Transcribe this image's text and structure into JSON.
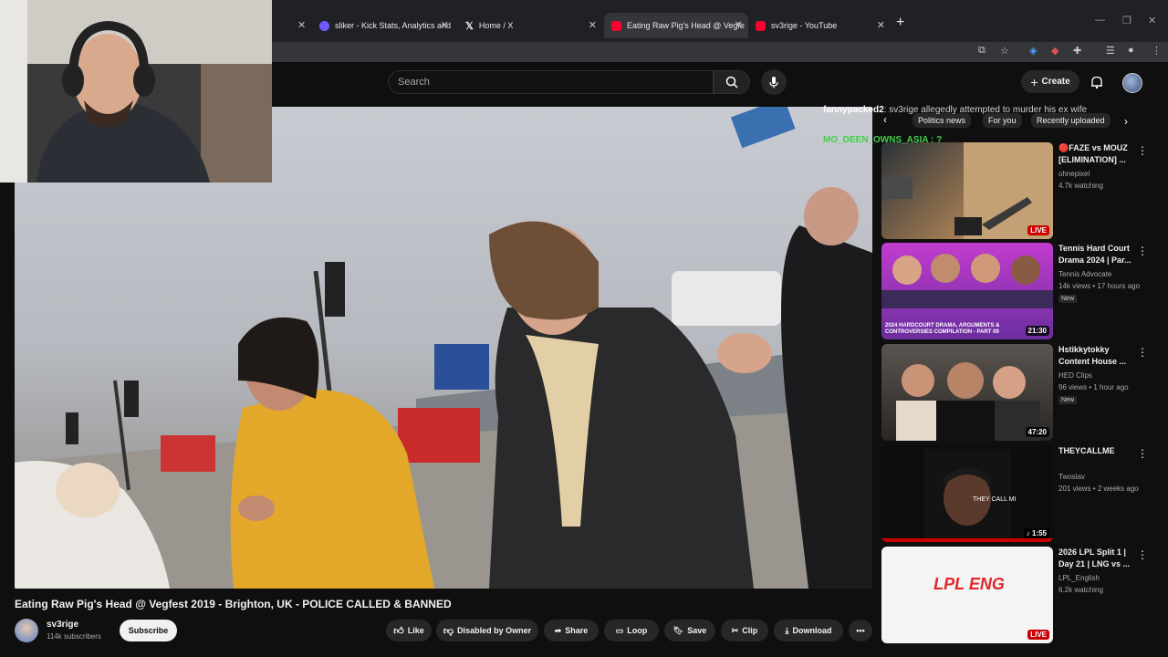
{
  "browser": {
    "tabs": [
      {
        "label": "sliker - Kick Stats, Analytics and",
        "color": "#6e5bff"
      },
      {
        "label": "Home / X",
        "color": "#ffffff"
      },
      {
        "label": "Eating Raw Pig's Head @ Vegfe",
        "color": "#ff0033"
      },
      {
        "label": "sv3rige - YouTube",
        "color": "#ff0033"
      }
    ]
  },
  "header": {
    "search_placeholder": "Search",
    "create_label": "Create"
  },
  "chat": {
    "line1_user": "fannypacked2",
    "line1_text": ": sv3rige allegedly attempted to murder his ex wife",
    "line2_user": "MO_DEEN_OWNS_ASIA",
    "line2_text": ": ?"
  },
  "chips": [
    "Politics news",
    "For you",
    "Recently uploaded"
  ],
  "video": {
    "title": "Eating Raw Pig's Head @ Vegfest 2019 - Brighton, UK - POLICE CALLED & BANNED",
    "channel": "sv3rige",
    "subscribers": "114k subscribers",
    "subscribe_label": "Subscribe",
    "actions": [
      "Like",
      "Disabled by Owner",
      "Share",
      "Loop",
      "Save",
      "Clip",
      "Download"
    ]
  },
  "recommendations": [
    {
      "title": "🔴FAZE vs MOUZ [ELIMINATION] ...",
      "channel": "ohnepixel",
      "meta": "4.7k watching",
      "badge": "LIVE",
      "badge_type": "live",
      "new": ""
    },
    {
      "title": "Tennis Hard Court Drama 2024 | Par...",
      "channel": "Tennis Advocate",
      "meta": "14k views • 17 hours ago",
      "badge": "21:30",
      "badge_type": "dur",
      "new": "New"
    },
    {
      "title": "Hstikkytokky Content House ...",
      "channel": "HED Clips",
      "meta": "96 views • 1 hour ago",
      "badge": "47:20",
      "badge_type": "dur",
      "new": "New"
    },
    {
      "title": "THEYCALLME",
      "channel": "Twoslav",
      "meta": "201 views • 2 weeks ago",
      "badge": "♪ 1:55",
      "badge_type": "dur",
      "new": ""
    },
    {
      "title": "2026 LPL Split 1 | Day 21 | LNG vs ...",
      "channel": "LPL_English",
      "meta": "6.2k watching",
      "badge": "LIVE",
      "badge_type": "live",
      "new": ""
    }
  ],
  "thumb_text": {
    "t2_caption": "2024 HARDCOURT DRAMA, ARGUMENTS & CONTROVERSIES COMPILATION - PART 09",
    "t4_caption": "THEY CALL MI",
    "t5_logo": "LPL ENG"
  }
}
